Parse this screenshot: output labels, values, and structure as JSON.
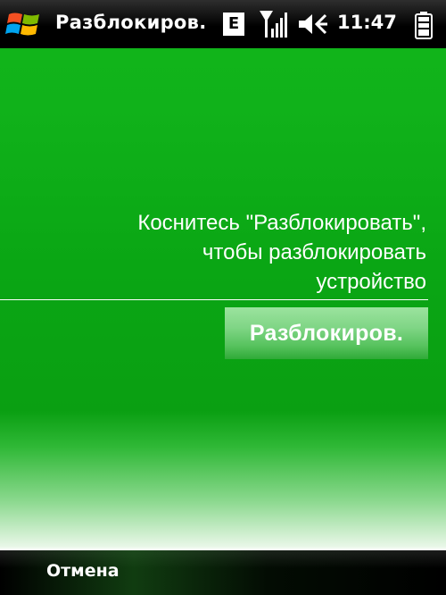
{
  "status_bar": {
    "title": "Разблокиров.",
    "network_badge": "E",
    "time": "11:47",
    "icons": [
      "windows-start-icon",
      "signal-icon",
      "volume-icon",
      "battery-icon"
    ]
  },
  "lock_screen": {
    "message_lines": [
      "Коснитесь \"Разблокировать\",",
      "чтобы разблокировать",
      "устройство"
    ],
    "unlock_button_label": "Разблокиров."
  },
  "softkeys": {
    "left_label": "Отмена"
  },
  "colors": {
    "background_green": "#10b21a",
    "bar_black": "#000000",
    "button_green": "#7fd585"
  }
}
